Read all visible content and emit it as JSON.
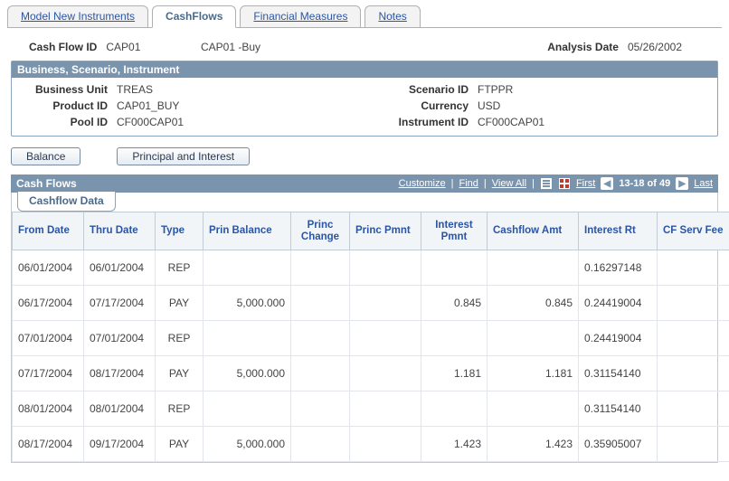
{
  "tabs": {
    "model_new_instruments": "Model New Instruments",
    "cashflows": "CashFlows",
    "financial_measures": "Financial Measures",
    "notes": "Notes"
  },
  "header": {
    "cash_flow_id_label": "Cash Flow ID",
    "cash_flow_id": "CAP01",
    "cash_flow_desc": "CAP01 -Buy",
    "analysis_date_label": "Analysis Date",
    "analysis_date": "05/26/2002"
  },
  "group": {
    "title": "Business, Scenario, Instrument",
    "business_unit_label": "Business Unit",
    "business_unit": "TREAS",
    "scenario_id_label": "Scenario ID",
    "scenario_id": "FTPPR",
    "product_id_label": "Product ID",
    "product_id": "CAP01_BUY",
    "currency_label": "Currency",
    "currency": "USD",
    "pool_id_label": "Pool ID",
    "pool_id": "CF000CAP01",
    "instrument_id_label": "Instrument ID",
    "instrument_id": "CF000CAP01"
  },
  "buttons": {
    "balance": "Balance",
    "principal_interest": "Principal and Interest"
  },
  "section": {
    "title": "Cash Flows",
    "subtab": "Cashflow Data",
    "customize": "Customize",
    "find": "Find",
    "view_all": "View All",
    "first": "First",
    "last": "Last",
    "range": "13-18 of 49"
  },
  "columns": {
    "from_date": "From Date",
    "thru_date": "Thru Date",
    "type": "Type",
    "prin_balance": "Prin Balance",
    "princ_change": "Princ Change",
    "princ_pmnt": "Princ Pmnt",
    "interest_pmnt": "Interest Pmnt",
    "cashflow_amt": "Cashflow Amt",
    "interest_rt": "Interest Rt",
    "cf_serv_fee": "CF Serv Fee"
  },
  "rows": [
    {
      "from_date": "06/01/2004",
      "thru_date": "06/01/2004",
      "type": "REP",
      "prin_balance": "",
      "princ_change": "",
      "princ_pmnt": "",
      "interest_pmnt": "",
      "cashflow_amt": "",
      "interest_rt": "0.16297148",
      "cf_serv_fee": ""
    },
    {
      "from_date": "06/17/2004",
      "thru_date": "07/17/2004",
      "type": "PAY",
      "prin_balance": "5,000.000",
      "princ_change": "",
      "princ_pmnt": "",
      "interest_pmnt": "0.845",
      "cashflow_amt": "0.845",
      "interest_rt": "0.24419004",
      "cf_serv_fee": ""
    },
    {
      "from_date": "07/01/2004",
      "thru_date": "07/01/2004",
      "type": "REP",
      "prin_balance": "",
      "princ_change": "",
      "princ_pmnt": "",
      "interest_pmnt": "",
      "cashflow_amt": "",
      "interest_rt": "0.24419004",
      "cf_serv_fee": ""
    },
    {
      "from_date": "07/17/2004",
      "thru_date": "08/17/2004",
      "type": "PAY",
      "prin_balance": "5,000.000",
      "princ_change": "",
      "princ_pmnt": "",
      "interest_pmnt": "1.181",
      "cashflow_amt": "1.181",
      "interest_rt": "0.31154140",
      "cf_serv_fee": ""
    },
    {
      "from_date": "08/01/2004",
      "thru_date": "08/01/2004",
      "type": "REP",
      "prin_balance": "",
      "princ_change": "",
      "princ_pmnt": "",
      "interest_pmnt": "",
      "cashflow_amt": "",
      "interest_rt": "0.31154140",
      "cf_serv_fee": ""
    },
    {
      "from_date": "08/17/2004",
      "thru_date": "09/17/2004",
      "type": "PAY",
      "prin_balance": "5,000.000",
      "princ_change": "",
      "princ_pmnt": "",
      "interest_pmnt": "1.423",
      "cashflow_amt": "1.423",
      "interest_rt": "0.35905007",
      "cf_serv_fee": ""
    }
  ]
}
